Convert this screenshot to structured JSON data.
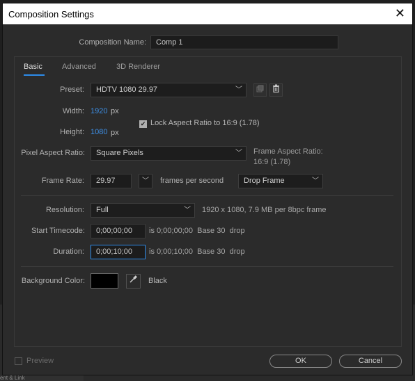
{
  "window": {
    "title": "Composition Settings"
  },
  "composition_name": {
    "label": "Composition Name:",
    "value": "Comp 1"
  },
  "tabs": [
    {
      "label": "Basic",
      "active": true
    },
    {
      "label": "Advanced",
      "active": false
    },
    {
      "label": "3D Renderer",
      "active": false
    }
  ],
  "preset": {
    "label": "Preset:",
    "value": "HDTV 1080 29.97"
  },
  "width": {
    "label": "Width:",
    "value": "1920",
    "unit": "px"
  },
  "height": {
    "label": "Height:",
    "value": "1080",
    "unit": "px"
  },
  "lock_aspect": {
    "label": "Lock Aspect Ratio to 16:9 (1.78)",
    "checked": true
  },
  "pixel_aspect": {
    "label": "Pixel Aspect Ratio:",
    "value": "Square Pixels"
  },
  "frame_aspect": {
    "line1": "Frame Aspect Ratio:",
    "line2": "16:9 (1.78)"
  },
  "frame_rate": {
    "label": "Frame Rate:",
    "value": "29.97",
    "unit": "frames per second",
    "drop_frame": "Drop Frame"
  },
  "resolution": {
    "label": "Resolution:",
    "value": "Full",
    "info": "1920 x 1080, 7.9 MB per 8bpc frame"
  },
  "start_timecode": {
    "label": "Start Timecode:",
    "value": "0;00;00;00",
    "info": "is 0;00;00;00  Base 30  drop"
  },
  "duration": {
    "label": "Duration:",
    "value": "0;00;10;00",
    "info": "is 0;00;10;00  Base 30  drop"
  },
  "background": {
    "label": "Background Color:",
    "color": "#000000",
    "name": "Black"
  },
  "footer": {
    "preview_label": "Preview",
    "ok_label": "OK",
    "cancel_label": "Cancel"
  },
  "background_app": {
    "text": "ent & Link"
  },
  "colors": {
    "accent": "#2d8ceb",
    "value_blue": "#3d8fe6"
  }
}
